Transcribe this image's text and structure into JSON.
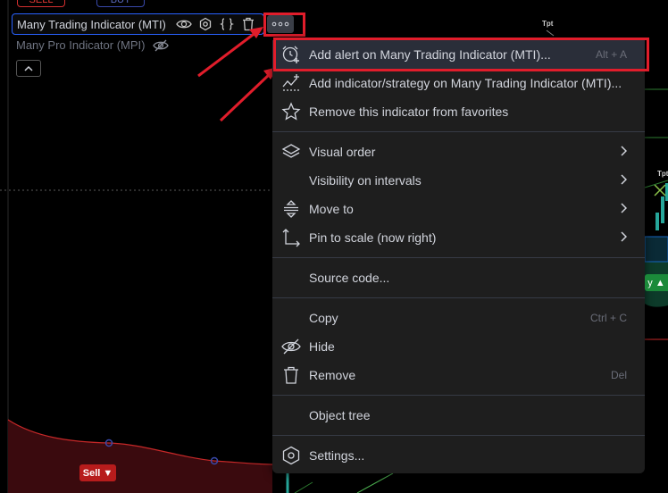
{
  "top_buttons": {
    "sell": "SELL",
    "buy": "BUY"
  },
  "legend": {
    "indicator_title": "Many Trading Indicator (MTI)",
    "secondary_indicator": "Many Pro Indicator (MPI)"
  },
  "chart": {
    "sell_badge": "Sell ▼",
    "buy_badge": "y ▲",
    "tpt_label_1": "Tpt",
    "tpt_label_2": "Tpt"
  },
  "menu": {
    "add_alert": {
      "label": "Add alert on Many Trading Indicator (MTI)...",
      "shortcut": "Alt + A"
    },
    "add_indicator": {
      "label": "Add indicator/strategy on Many Trading Indicator (MTI)..."
    },
    "remove_favorites": {
      "label": "Remove this indicator from favorites"
    },
    "visual_order": {
      "label": "Visual order"
    },
    "visibility_intervals": {
      "label": "Visibility on intervals"
    },
    "move_to": {
      "label": "Move to"
    },
    "pin_to_scale": {
      "label": "Pin to scale (now right)"
    },
    "source_code": {
      "label": "Source code..."
    },
    "copy": {
      "label": "Copy",
      "shortcut": "Ctrl + C"
    },
    "hide": {
      "label": "Hide"
    },
    "remove": {
      "label": "Remove",
      "shortcut": "Del"
    },
    "object_tree": {
      "label": "Object tree"
    },
    "settings": {
      "label": "Settings..."
    }
  },
  "colors": {
    "highlight_red": "#e11d2b",
    "accent_blue": "#2962ff",
    "menu_bg": "#1e1e1e",
    "sell_red": "#b71c1c",
    "buy_green": "#1b8a3a"
  },
  "icons": [
    "eye-icon",
    "settings-hex-icon",
    "braces-icon",
    "trash-icon",
    "more-dots-icon",
    "eye-slash-icon",
    "chevron-up-icon",
    "alarm-clock-plus-icon",
    "chart-plus-icon",
    "star-icon",
    "layers-icon",
    "move-to-icon",
    "pin-scale-icon",
    "trash-icon",
    "hexagon-settings-icon",
    "chevron-right-icon"
  ]
}
